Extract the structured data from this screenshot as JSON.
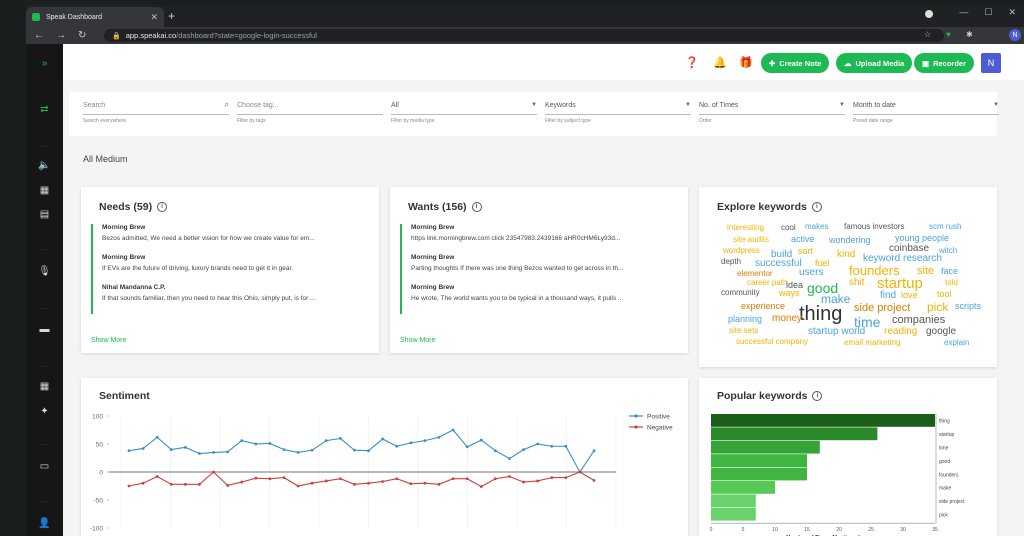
{
  "browser": {
    "tab_title": "Speak Dashboard",
    "url_host": "app.speakai.co",
    "url_path": "/dashboard?state=google-login-successful",
    "profile_initial": "N"
  },
  "appbar": {
    "create_note": "Create Note",
    "upload_media": "Upload Media",
    "recorder": "Recorder",
    "user_initial": "N"
  },
  "filters": [
    {
      "value": "Search",
      "help": "Search everywhere"
    },
    {
      "value": "Choose tag...",
      "help": "Filter by tags"
    },
    {
      "value": "All",
      "help": "Filter by media type"
    },
    {
      "value": "Keywords",
      "help": "Filter by subject type"
    },
    {
      "value": "No. of Times",
      "help": "Order"
    },
    {
      "value": "Month to date",
      "help": "Preset date range"
    }
  ],
  "section_title": "All Medium",
  "needs": {
    "title": "Needs (59)",
    "items": [
      {
        "source": "Morning Brew",
        "text": "Bezos admitted, We need a better vision for how we create value for em..."
      },
      {
        "source": "Morning Brew",
        "text": "If EVs are the future of driving, luxury brands need to get it in gear."
      },
      {
        "source": "Nihal Mandanna C.P.",
        "text": "If that sounds familiar, then you need to hear this Ohio, simply put, is for ..."
      }
    ],
    "show_more": "Show More"
  },
  "wants": {
    "title": "Wants (156)",
    "items": [
      {
        "source": "Morning Brew",
        "text": "https link.morningbrew.com click 23547983.2439166 aHR0cHM6Ly93d..."
      },
      {
        "source": "Morning Brew",
        "text": "Parting thoughts If there was one thing Bezos wanted to get across in th..."
      },
      {
        "source": "Morning Brew",
        "text": "He wrote, The world wants you to be typical in a thousand ways, it pulls ..."
      }
    ],
    "show_more": "Show More"
  },
  "explore": {
    "title": "Explore keywords",
    "words": [
      "interesting",
      "cool",
      "makes",
      "famous investors",
      "scm rush",
      "site audits",
      "active",
      "wondering",
      "young people",
      "wordpress",
      "coinbase",
      "witch",
      "depth",
      "build",
      "sort",
      "kind",
      "keyword research",
      "successful",
      "fuel",
      "elementor",
      "users",
      "founders",
      "site",
      "face",
      "career path",
      "startup",
      "told",
      "community",
      "ways",
      "good",
      "shit",
      "idea",
      "make",
      "find",
      "love",
      "tool",
      "side project",
      "scripts",
      "experience",
      "thing",
      "pick",
      "planning",
      "money",
      "time",
      "companies",
      "site sets",
      "startup world",
      "reading",
      "google",
      "successful company",
      "email marketing",
      "explain"
    ]
  },
  "sentiment": {
    "title": "Sentiment"
  },
  "popular": {
    "title": "Popular keywords",
    "xlabel": "Number of Times Mentioned"
  },
  "chart_data": [
    {
      "type": "line",
      "title": "Sentiment",
      "ylim": [
        -100,
        100
      ],
      "yticks": [
        100,
        50,
        0,
        -50,
        -100
      ],
      "legend_position": "top-right",
      "series": [
        {
          "name": "Positive",
          "color": "#3a8fc4",
          "values": [
            38,
            42,
            62,
            40,
            44,
            33,
            35,
            36,
            56,
            50,
            51,
            40,
            35,
            39,
            56,
            60,
            39,
            38,
            59,
            46,
            52,
            56,
            62,
            75,
            45,
            57,
            38,
            24,
            40,
            50,
            46,
            46,
            0,
            38
          ]
        },
        {
          "name": "Negative",
          "color": "#d23f3f",
          "values": [
            -25,
            -20,
            -8,
            -22,
            -22,
            -22,
            0,
            -24,
            -18,
            -11,
            -12,
            -10,
            -25,
            -20,
            -16,
            -12,
            -22,
            -20,
            -17,
            -12,
            -21,
            -20,
            -22,
            -12,
            -12,
            -26,
            -12,
            -8,
            -18,
            -16,
            -10,
            -10,
            0,
            -15
          ]
        }
      ]
    },
    {
      "type": "bar",
      "orientation": "horizontal",
      "title": "Popular keywords",
      "xlabel": "Number of Times Mentioned",
      "xlim": [
        0,
        35
      ],
      "xticks": [
        0,
        5,
        10,
        15,
        20,
        25,
        30,
        35
      ],
      "categories": [
        "thing",
        "startup",
        "time",
        "good",
        "founders",
        "make",
        "side project",
        "pick"
      ],
      "values": [
        35,
        26,
        17,
        15,
        15,
        10,
        7,
        7
      ]
    }
  ]
}
